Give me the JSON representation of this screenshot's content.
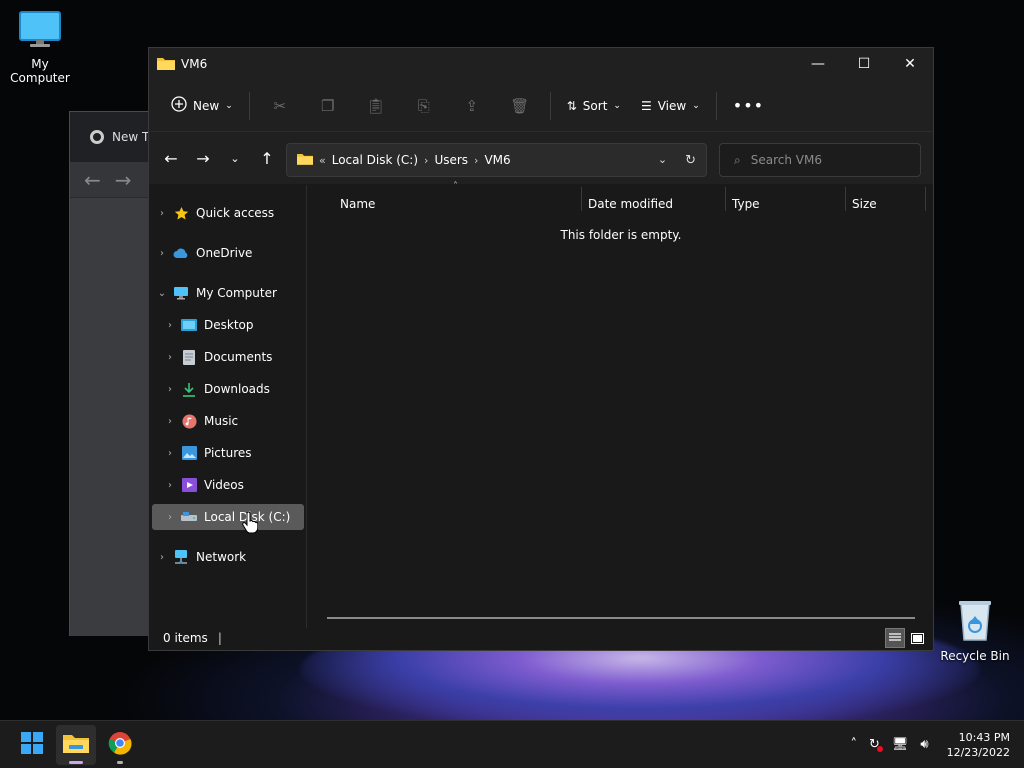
{
  "desktop": {
    "icons": [
      {
        "label": "My Computer",
        "icon": "monitor-icon"
      },
      {
        "label": "Recycle Bin",
        "icon": "recycle-bin-icon"
      }
    ]
  },
  "chrome_window": {
    "tab_label": "New Ta"
  },
  "explorer": {
    "title": "VM6",
    "command_bar": {
      "new_label": "New",
      "sort_label": "Sort",
      "view_label": "View",
      "icons": [
        "cut-icon",
        "copy-icon",
        "paste-icon",
        "rename-icon",
        "share-icon",
        "delete-icon",
        "more-icon"
      ]
    },
    "address": {
      "overflow": "«",
      "crumbs": [
        "Local Disk (C:)",
        "Users",
        "VM6"
      ]
    },
    "search": {
      "placeholder": "Search VM6"
    },
    "nav_pane": {
      "items": [
        {
          "label": "Quick access",
          "icon": "star-icon",
          "expanded": false
        },
        {
          "label": "OneDrive",
          "icon": "cloud-icon",
          "expanded": false
        },
        {
          "label": "My Computer",
          "icon": "monitor-icon",
          "expanded": true
        },
        {
          "label": "Desktop",
          "icon": "desktop-folder-icon",
          "expanded": false
        },
        {
          "label": "Documents",
          "icon": "documents-icon",
          "expanded": false
        },
        {
          "label": "Downloads",
          "icon": "download-icon",
          "expanded": false
        },
        {
          "label": "Music",
          "icon": "music-icon",
          "expanded": false
        },
        {
          "label": "Pictures",
          "icon": "pictures-icon",
          "expanded": false
        },
        {
          "label": "Videos",
          "icon": "videos-icon",
          "expanded": false
        },
        {
          "label": "Local Disk (C:)",
          "icon": "drive-icon",
          "expanded": false,
          "selected": true
        },
        {
          "label": "Network",
          "icon": "network-icon",
          "expanded": false
        }
      ]
    },
    "columns": [
      "Name",
      "Date modified",
      "Type",
      "Size"
    ],
    "empty_message": "This folder is empty.",
    "status": {
      "items_count": "0 items"
    }
  },
  "taskbar": {
    "apps": [
      "start-icon",
      "file-explorer-icon",
      "chrome-icon"
    ],
    "clock": {
      "time": "10:43 PM",
      "date": "12/23/2022"
    }
  },
  "colors": {
    "window_bg": "#191919",
    "chrome_bg": "#202020",
    "selection": "#5a5a5a",
    "folder_yellow": "#f3c13a",
    "accent_blue": "#3a96dd"
  }
}
